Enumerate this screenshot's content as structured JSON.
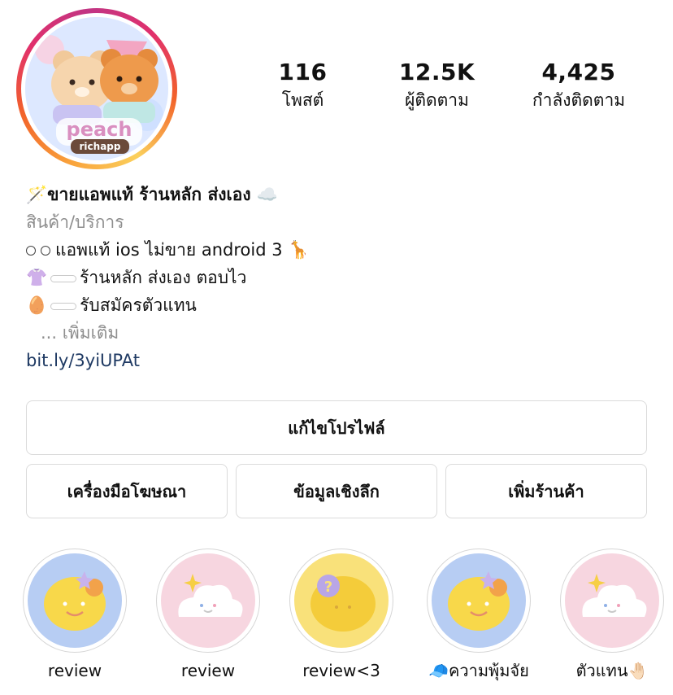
{
  "profile": {
    "avatar_text_main": "peach",
    "avatar_text_sub": "richapp"
  },
  "stats": [
    {
      "value": "116",
      "label": "โพสต์"
    },
    {
      "value": "12.5K",
      "label": "ผู้ติดตาม"
    },
    {
      "value": "4,425",
      "label": "กำลังติดตาม"
    }
  ],
  "bio": {
    "name_icon": "🪄",
    "name": "ขายแอพแท้ ร้านหลัก ส่งเอง",
    "name_trailing_icon": "☁️",
    "category": "สินค้า/บริการ",
    "line1_text": "แอพแท้ ios ไม่ขาย android 3",
    "line1_emoji": "🦒",
    "line2_emoji": "👚",
    "line2_text": "ร้านหลัก ส่งเอง ตอบไว",
    "line3_emoji": "🥚",
    "line3_text": "รับสมัครตัวแทน",
    "more": "... เพิ่มเติม",
    "link": "bit.ly/3yiUPAt"
  },
  "buttons": {
    "edit_profile": "แก้ไขโปรไฟล์",
    "ad_tools": "เครื่องมือโฆษณา",
    "insights": "ข้อมูลเชิงลึก",
    "add_shop": "เพิ่มร้านค้า"
  },
  "highlights": [
    {
      "label": "review",
      "theme": "lemon-blue"
    },
    {
      "label": "review",
      "theme": "cloud-pink"
    },
    {
      "label": "review<3",
      "theme": "lemon-yellow"
    },
    {
      "label": "🧢ความพุ้มจัย",
      "theme": "lemon-blue"
    },
    {
      "label": "ตัวแทน🤚🏻",
      "theme": "cloud-pink"
    }
  ],
  "colors": {
    "link": "#1f3a63",
    "secondary_text": "#8e8e8e",
    "button_border": "#dbdbdb",
    "highlight_blue": "#b7cdf3",
    "highlight_pink": "#f7d6e0",
    "highlight_yellow": "#f9e17a"
  }
}
